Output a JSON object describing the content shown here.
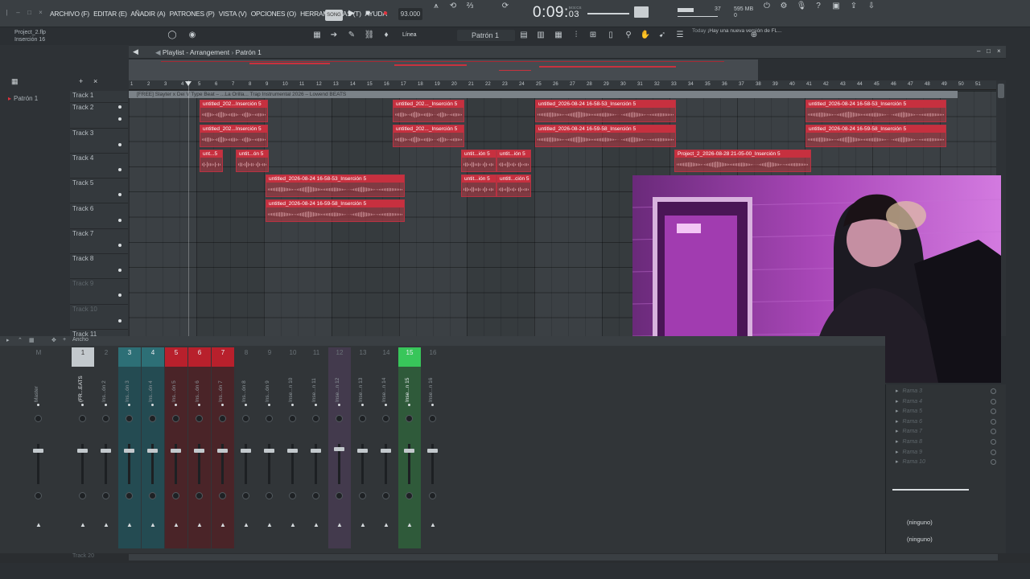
{
  "menu": [
    "ARCHIVO (F)",
    "EDITAR (E)",
    "AÑADIR (A)",
    "PATRONES (P)",
    "VISTA (V)",
    "OPCIONES (O)",
    "HERRAMIENTAS (T)",
    "AYUDA"
  ],
  "transport": {
    "mode": "SONG",
    "tempo": "93.000",
    "time_main": "0:09:",
    "time_sub": "03",
    "time_unit": "M:S:CS"
  },
  "meters": {
    "cpu": "37",
    "mem_mb": "595 MB",
    "mem_sub": "0"
  },
  "project": {
    "file": "Project_2.flp",
    "insert": "Inserción 16"
  },
  "snap": "Línea",
  "pattern_selector": "Patrón 1",
  "news": {
    "label": "Today",
    "text": "¡Hay una nueva versión de FL..."
  },
  "playlist": {
    "title": "Playlist - Arrangement",
    "pattern": "Patrón 1"
  },
  "picker": {
    "item": "Patrón 1"
  },
  "ruler_ticks": [
    "1",
    "2",
    "3",
    "4",
    "5",
    "6",
    "7",
    "8",
    "9",
    "10",
    "11",
    "12",
    "13",
    "14",
    "15",
    "16",
    "17",
    "18",
    "19",
    "20",
    "21",
    "22",
    "23",
    "24",
    "25",
    "26",
    "27",
    "28",
    "29",
    "30",
    "31",
    "32",
    "33",
    "34",
    "35",
    "36",
    "37",
    "38",
    "39",
    "40",
    "41",
    "42",
    "43",
    "44",
    "45",
    "46",
    "47",
    "48",
    "49",
    "50",
    "51"
  ],
  "top_clip": "[FREE] Slayter x Dei V Type Beat – ...La Orilla... Trap Instrumental 2026 – Lowend BEATS",
  "tracks": [
    "Track 1",
    "Track 2",
    "Track 3",
    "Track 4",
    "Track 5",
    "Track 6",
    "Track 7",
    "Track 8",
    "Track 9",
    "Track 10",
    "Track 11"
  ],
  "clips": [
    {
      "label": "untitled_202...Inserción 5"
    },
    {
      "label": "untitled_202...Inserción 5"
    },
    {
      "label": "untitled_202..._Inserción 5"
    },
    {
      "label": "untitled_202..._Inserción 5"
    },
    {
      "label": "untitled_2026-08-24 16-58-53_Inserción 5"
    },
    {
      "label": "untitled_2026-08-24 16-59-58_Inserción 5"
    },
    {
      "label": "untitled_2026-08-24 16-58-53_Inserción 5"
    },
    {
      "label": "untitled_2026-08-24 16-59-58_Inserción 5"
    },
    {
      "label": "unt...5"
    },
    {
      "label": "untit...ón 5"
    },
    {
      "label": "untit...ión 5"
    },
    {
      "label": "untit...ión 5"
    },
    {
      "label": "Project_2_2026-08-28 21-05-00_Inserción 5"
    },
    {
      "label": "untitled_2026-08-24 16-58-53_Inserción 5"
    },
    {
      "label": "untit...ión 5"
    },
    {
      "label": "untitl...ción 5"
    },
    {
      "label": "untitled_2026-08-24 16-59-58_Inserción 5"
    }
  ],
  "mixer": {
    "mode": "Ancho",
    "strips": [
      {
        "num": "M",
        "label": "Master"
      },
      {
        "num": "1",
        "label": "(FR...EATS"
      },
      {
        "num": "2",
        "label": "Ins...ón 2"
      },
      {
        "num": "3",
        "label": "Ins...ón 3"
      },
      {
        "num": "4",
        "label": "Ins...ón 4"
      },
      {
        "num": "5",
        "label": "Ins...ón 5"
      },
      {
        "num": "6",
        "label": "Ins...ón 6"
      },
      {
        "num": "7",
        "label": "Ins...ón 7"
      },
      {
        "num": "8",
        "label": "Ins...ón 8"
      },
      {
        "num": "9",
        "label": "Ins...ón 9"
      },
      {
        "num": "10",
        "label": "Inse...n 10"
      },
      {
        "num": "11",
        "label": "Inse...n 11"
      },
      {
        "num": "12",
        "label": "Inse...n 12"
      },
      {
        "num": "13",
        "label": "Inse...n 13"
      },
      {
        "num": "14",
        "label": "Inse...n 14"
      },
      {
        "num": "15",
        "label": "Inse...n 15"
      },
      {
        "num": "16",
        "label": "Inse...n 16"
      }
    ]
  },
  "routing": {
    "ramas": [
      "Rama 3",
      "Rama 4",
      "Rama 5",
      "Rama 6",
      "Rama 7",
      "Rama 8",
      "Rama 9",
      "Rama 10"
    ],
    "in_select": "(ninguno)",
    "out_select": "(ninguno)"
  },
  "bottom_track": "Track 20",
  "colors": {
    "clip": "#c7303f",
    "accent_teal": "#2d7f86",
    "accent_red": "#c7202c",
    "accent_green": "#3ddc64",
    "accent_purple": "#7a5b86"
  }
}
